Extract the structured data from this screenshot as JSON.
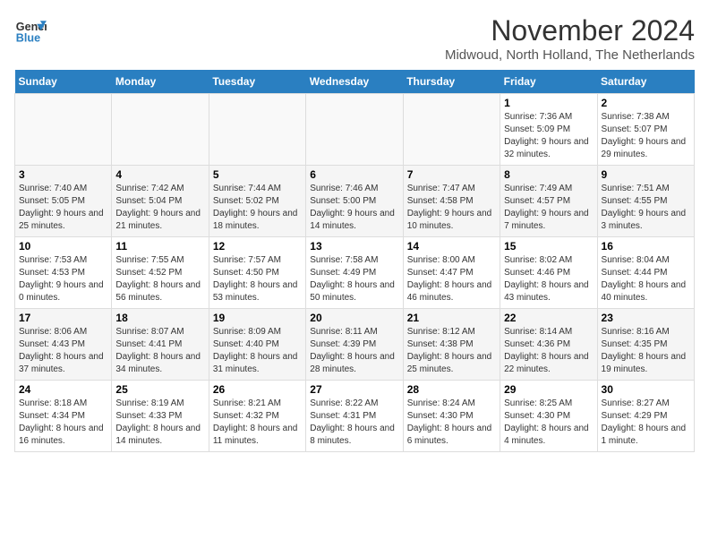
{
  "header": {
    "logo_line1": "General",
    "logo_line2": "Blue",
    "month": "November 2024",
    "location": "Midwoud, North Holland, The Netherlands"
  },
  "weekdays": [
    "Sunday",
    "Monday",
    "Tuesday",
    "Wednesday",
    "Thursday",
    "Friday",
    "Saturday"
  ],
  "rows": [
    [
      {
        "day": "",
        "info": ""
      },
      {
        "day": "",
        "info": ""
      },
      {
        "day": "",
        "info": ""
      },
      {
        "day": "",
        "info": ""
      },
      {
        "day": "",
        "info": ""
      },
      {
        "day": "1",
        "info": "Sunrise: 7:36 AM\nSunset: 5:09 PM\nDaylight: 9 hours and 32 minutes."
      },
      {
        "day": "2",
        "info": "Sunrise: 7:38 AM\nSunset: 5:07 PM\nDaylight: 9 hours and 29 minutes."
      }
    ],
    [
      {
        "day": "3",
        "info": "Sunrise: 7:40 AM\nSunset: 5:05 PM\nDaylight: 9 hours and 25 minutes."
      },
      {
        "day": "4",
        "info": "Sunrise: 7:42 AM\nSunset: 5:04 PM\nDaylight: 9 hours and 21 minutes."
      },
      {
        "day": "5",
        "info": "Sunrise: 7:44 AM\nSunset: 5:02 PM\nDaylight: 9 hours and 18 minutes."
      },
      {
        "day": "6",
        "info": "Sunrise: 7:46 AM\nSunset: 5:00 PM\nDaylight: 9 hours and 14 minutes."
      },
      {
        "day": "7",
        "info": "Sunrise: 7:47 AM\nSunset: 4:58 PM\nDaylight: 9 hours and 10 minutes."
      },
      {
        "day": "8",
        "info": "Sunrise: 7:49 AM\nSunset: 4:57 PM\nDaylight: 9 hours and 7 minutes."
      },
      {
        "day": "9",
        "info": "Sunrise: 7:51 AM\nSunset: 4:55 PM\nDaylight: 9 hours and 3 minutes."
      }
    ],
    [
      {
        "day": "10",
        "info": "Sunrise: 7:53 AM\nSunset: 4:53 PM\nDaylight: 9 hours and 0 minutes."
      },
      {
        "day": "11",
        "info": "Sunrise: 7:55 AM\nSunset: 4:52 PM\nDaylight: 8 hours and 56 minutes."
      },
      {
        "day": "12",
        "info": "Sunrise: 7:57 AM\nSunset: 4:50 PM\nDaylight: 8 hours and 53 minutes."
      },
      {
        "day": "13",
        "info": "Sunrise: 7:58 AM\nSunset: 4:49 PM\nDaylight: 8 hours and 50 minutes."
      },
      {
        "day": "14",
        "info": "Sunrise: 8:00 AM\nSunset: 4:47 PM\nDaylight: 8 hours and 46 minutes."
      },
      {
        "day": "15",
        "info": "Sunrise: 8:02 AM\nSunset: 4:46 PM\nDaylight: 8 hours and 43 minutes."
      },
      {
        "day": "16",
        "info": "Sunrise: 8:04 AM\nSunset: 4:44 PM\nDaylight: 8 hours and 40 minutes."
      }
    ],
    [
      {
        "day": "17",
        "info": "Sunrise: 8:06 AM\nSunset: 4:43 PM\nDaylight: 8 hours and 37 minutes."
      },
      {
        "day": "18",
        "info": "Sunrise: 8:07 AM\nSunset: 4:41 PM\nDaylight: 8 hours and 34 minutes."
      },
      {
        "day": "19",
        "info": "Sunrise: 8:09 AM\nSunset: 4:40 PM\nDaylight: 8 hours and 31 minutes."
      },
      {
        "day": "20",
        "info": "Sunrise: 8:11 AM\nSunset: 4:39 PM\nDaylight: 8 hours and 28 minutes."
      },
      {
        "day": "21",
        "info": "Sunrise: 8:12 AM\nSunset: 4:38 PM\nDaylight: 8 hours and 25 minutes."
      },
      {
        "day": "22",
        "info": "Sunrise: 8:14 AM\nSunset: 4:36 PM\nDaylight: 8 hours and 22 minutes."
      },
      {
        "day": "23",
        "info": "Sunrise: 8:16 AM\nSunset: 4:35 PM\nDaylight: 8 hours and 19 minutes."
      }
    ],
    [
      {
        "day": "24",
        "info": "Sunrise: 8:18 AM\nSunset: 4:34 PM\nDaylight: 8 hours and 16 minutes."
      },
      {
        "day": "25",
        "info": "Sunrise: 8:19 AM\nSunset: 4:33 PM\nDaylight: 8 hours and 14 minutes."
      },
      {
        "day": "26",
        "info": "Sunrise: 8:21 AM\nSunset: 4:32 PM\nDaylight: 8 hours and 11 minutes."
      },
      {
        "day": "27",
        "info": "Sunrise: 8:22 AM\nSunset: 4:31 PM\nDaylight: 8 hours and 8 minutes."
      },
      {
        "day": "28",
        "info": "Sunrise: 8:24 AM\nSunset: 4:30 PM\nDaylight: 8 hours and 6 minutes."
      },
      {
        "day": "29",
        "info": "Sunrise: 8:25 AM\nSunset: 4:30 PM\nDaylight: 8 hours and 4 minutes."
      },
      {
        "day": "30",
        "info": "Sunrise: 8:27 AM\nSunset: 4:29 PM\nDaylight: 8 hours and 1 minute."
      }
    ]
  ]
}
